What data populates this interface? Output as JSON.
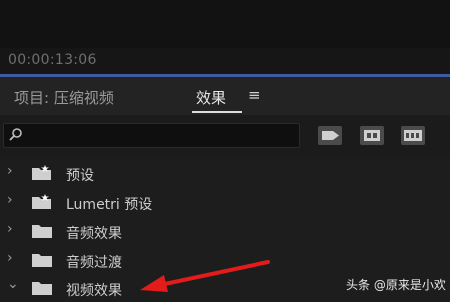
{
  "timecode": "00:00:13:06",
  "tabs": {
    "project": "项目: 压缩视频",
    "effects": "效果",
    "menu_icon": "≡"
  },
  "search": {
    "placeholder": "",
    "value": ""
  },
  "toolbar": {
    "btn1": "accelerated-effects-icon",
    "btn2": "32-bit-color-icon",
    "btn3": "yuv-effects-icon"
  },
  "tree": [
    {
      "label": "预设",
      "expanded": false,
      "icon": "preset-folder-icon"
    },
    {
      "label": "Lumetri 预设",
      "expanded": false,
      "icon": "preset-folder-icon"
    },
    {
      "label": "音频效果",
      "expanded": false,
      "icon": "folder-icon"
    },
    {
      "label": "音频过渡",
      "expanded": false,
      "icon": "folder-icon"
    },
    {
      "label": "视频效果",
      "expanded": true,
      "icon": "folder-icon"
    }
  ],
  "watermark": "头条 @原来是小欢",
  "annotation_color": "#e21b1b"
}
